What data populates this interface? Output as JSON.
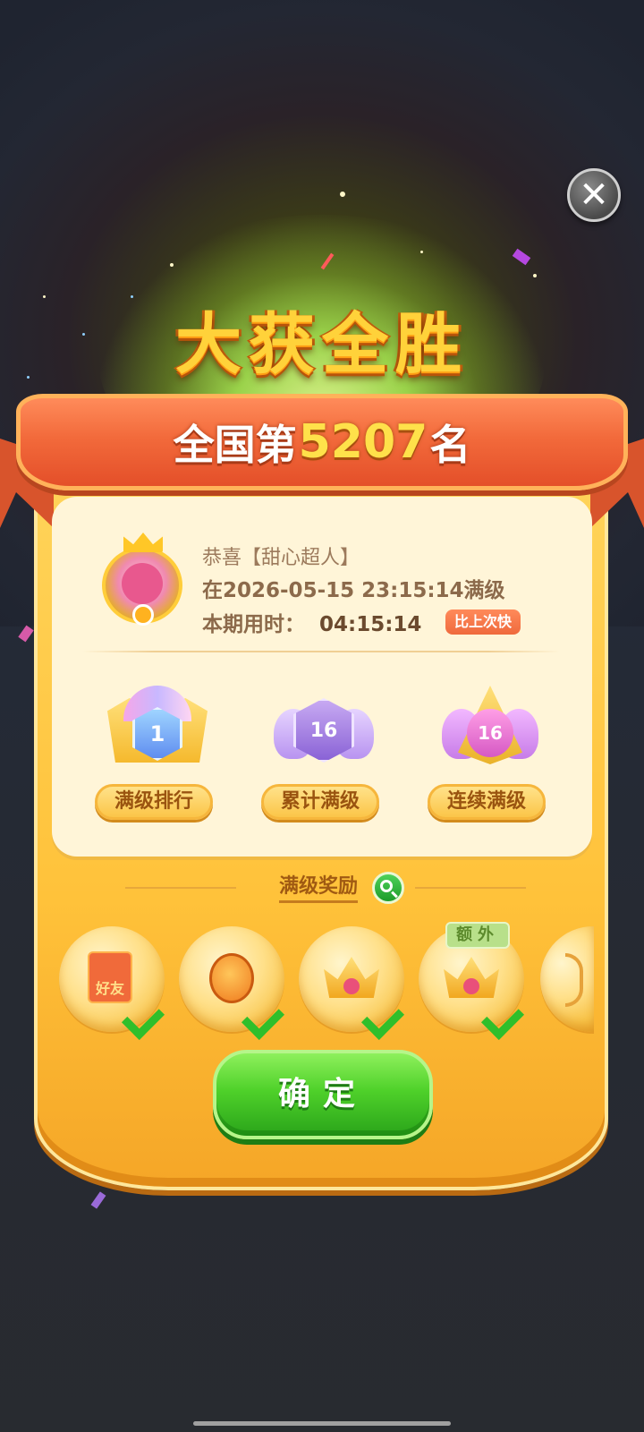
{
  "title": "大获全胜",
  "rank": {
    "prefix": "全国第",
    "number": "5207",
    "suffix": "名"
  },
  "profile": {
    "congrats": "恭喜【甜心超人】",
    "date_line": "在2026-05-15 23:15:14满级",
    "time_label": "本期用时：",
    "time_value": "04:15:14",
    "faster_badge": "比上次快"
  },
  "stats": [
    {
      "label": "满级排行",
      "value": "1"
    },
    {
      "label": "累计满级",
      "value": "16"
    },
    {
      "label": "连续满级",
      "value": "16"
    }
  ],
  "rewards": {
    "title": "满级奖励",
    "items": [
      {
        "icon": "red-envelope-icon",
        "text": "好友",
        "claimed": true
      },
      {
        "icon": "fruit-icon",
        "claimed": true
      },
      {
        "icon": "crown-icon",
        "claimed": true
      },
      {
        "icon": "crown-icon",
        "claimed": true,
        "tag": "额外"
      },
      {
        "icon": "bow-icon",
        "claimed": false
      }
    ]
  },
  "confirm_label": "确定",
  "close_icon": "close-icon"
}
